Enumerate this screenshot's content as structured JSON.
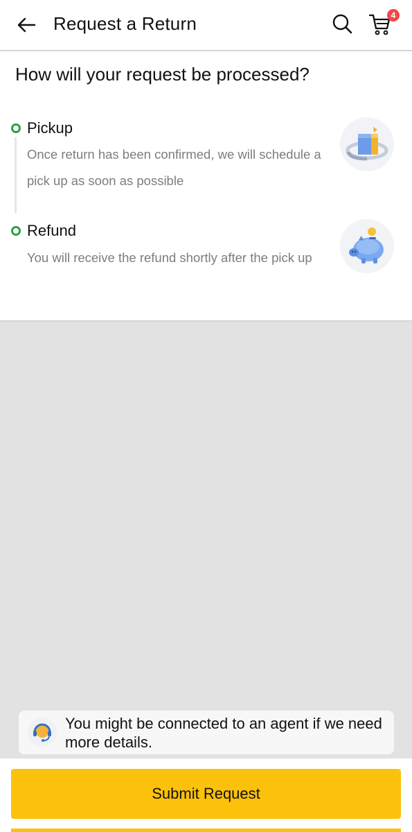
{
  "colors": {
    "accent": "#fcc10a",
    "step_dot": "#2ea043",
    "badge": "#f04848"
  },
  "header": {
    "back_icon": "arrow-left-icon",
    "title": "Request a Return",
    "search_icon": "search-icon",
    "cart_icon": "cart-icon",
    "cart_count": "4"
  },
  "process": {
    "heading": "How will your request be processed?",
    "steps": [
      {
        "title": "Pickup",
        "description": "Once return has been confirmed, we will schedule a pick up as soon as possible",
        "illustration": "package-return-icon"
      },
      {
        "title": "Refund",
        "description": "You will receive the refund shortly after the pick up",
        "illustration": "piggy-bank-icon"
      }
    ]
  },
  "agent_notice": {
    "icon": "headset-agent-icon",
    "text": "You might be connected to an agent if we need more details."
  },
  "footer": {
    "submit_label": "Submit Request"
  }
}
